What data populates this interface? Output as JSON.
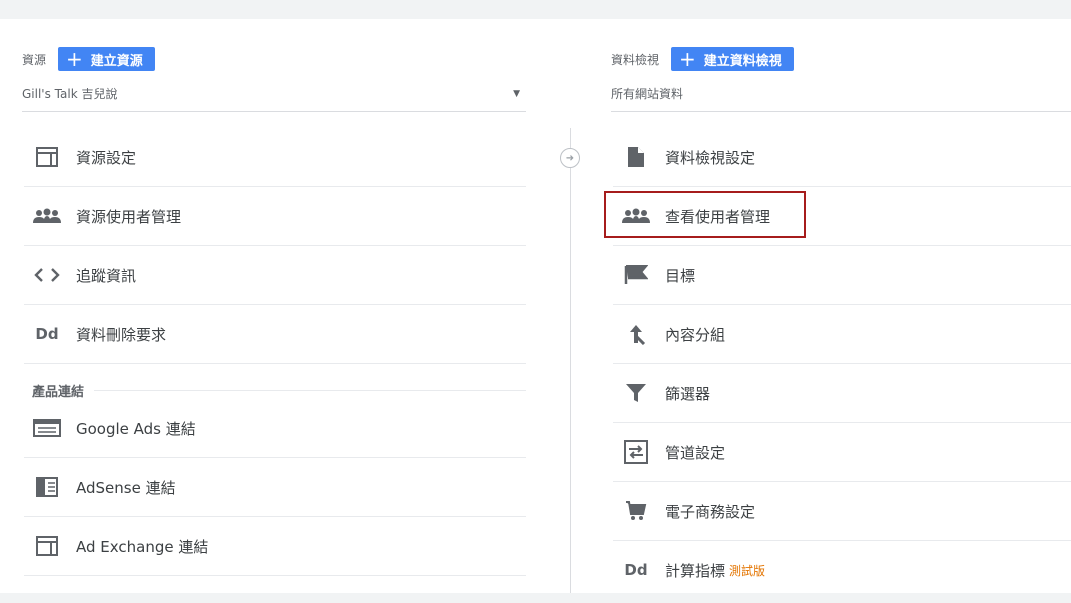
{
  "left": {
    "label": "資源",
    "create_button": "建立資源",
    "selector_value": "Gill's Talk 吉兒說",
    "items": [
      {
        "label": "資源設定"
      },
      {
        "label": "資源使用者管理"
      },
      {
        "label": "追蹤資訊"
      },
      {
        "label": "資料刪除要求"
      }
    ],
    "section_title": "產品連結",
    "links": [
      {
        "label": "Google Ads 連結"
      },
      {
        "label": "AdSense 連結"
      },
      {
        "label": "Ad Exchange 連結"
      }
    ]
  },
  "right": {
    "label": "資料檢視",
    "create_button": "建立資料檢視",
    "selector_value": "所有網站資料",
    "items": [
      {
        "label": "資料檢視設定"
      },
      {
        "label": "查看使用者管理"
      },
      {
        "label": "目標"
      },
      {
        "label": "內容分組"
      },
      {
        "label": "篩選器"
      },
      {
        "label": "管道設定"
      },
      {
        "label": "電子商務設定"
      },
      {
        "label": "計算指標",
        "badge": "測試版"
      }
    ]
  },
  "colors": {
    "accent": "#4285f4",
    "highlight": "#a61c1c",
    "beta": "#e37400"
  }
}
